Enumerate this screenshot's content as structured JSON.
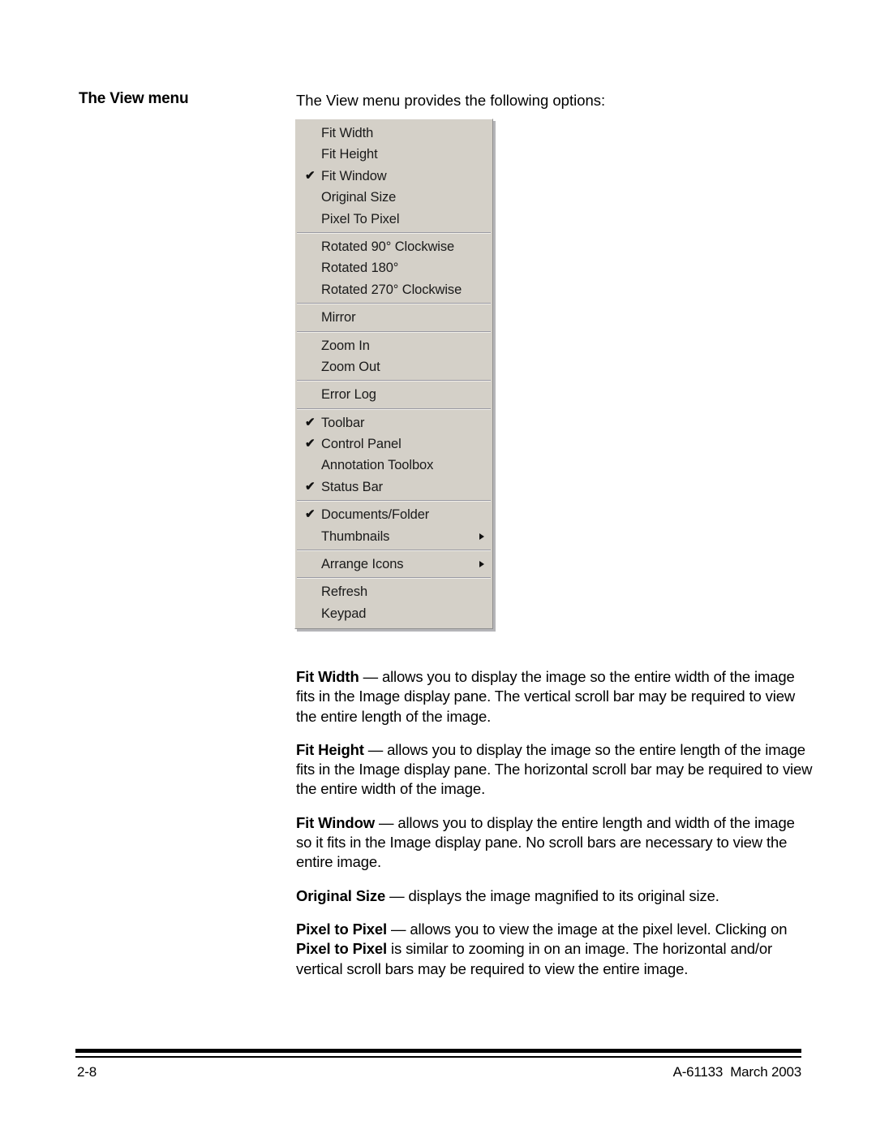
{
  "page": {
    "heading": "The View menu",
    "intro": "The View menu provides the following options:"
  },
  "menu": {
    "name": "View",
    "background_color": "#d4d0c8",
    "groups": [
      {
        "items": [
          {
            "label": "Fit Width",
            "checked": false,
            "submenu": false
          },
          {
            "label": "Fit Height",
            "checked": false,
            "submenu": false
          },
          {
            "label": "Fit Window",
            "checked": true,
            "submenu": false
          },
          {
            "label": "Original Size",
            "checked": false,
            "submenu": false
          },
          {
            "label": "Pixel To Pixel",
            "checked": false,
            "submenu": false
          }
        ]
      },
      {
        "items": [
          {
            "label": "Rotated 90° Clockwise",
            "checked": false,
            "submenu": false
          },
          {
            "label": "Rotated 180°",
            "checked": false,
            "submenu": false
          },
          {
            "label": "Rotated 270° Clockwise",
            "checked": false,
            "submenu": false
          }
        ]
      },
      {
        "items": [
          {
            "label": "Mirror",
            "checked": false,
            "submenu": false
          }
        ]
      },
      {
        "items": [
          {
            "label": "Zoom In",
            "checked": false,
            "submenu": false
          },
          {
            "label": "Zoom Out",
            "checked": false,
            "submenu": false
          }
        ]
      },
      {
        "items": [
          {
            "label": "Error Log",
            "checked": false,
            "submenu": false
          }
        ]
      },
      {
        "items": [
          {
            "label": "Toolbar",
            "checked": true,
            "submenu": false
          },
          {
            "label": "Control Panel",
            "checked": true,
            "submenu": false
          },
          {
            "label": "Annotation Toolbox",
            "checked": false,
            "submenu": false
          },
          {
            "label": "Status Bar",
            "checked": true,
            "submenu": false
          }
        ]
      },
      {
        "items": [
          {
            "label": "Documents/Folder",
            "checked": true,
            "submenu": false
          },
          {
            "label": "Thumbnails",
            "checked": false,
            "submenu": true
          }
        ]
      },
      {
        "items": [
          {
            "label": "Arrange Icons",
            "checked": false,
            "submenu": true
          }
        ]
      },
      {
        "items": [
          {
            "label": "Refresh",
            "checked": false,
            "submenu": false
          },
          {
            "label": "Keypad",
            "checked": false,
            "submenu": false
          }
        ]
      }
    ],
    "checkmark_glyph": "✔",
    "submenu_glyph": "▶"
  },
  "descriptions": [
    {
      "term": "Fit Width",
      "dash": " — ",
      "text": "allows you to display the image so the entire width of the image fits in the Image display pane.  The vertical scroll bar may be required to view the entire length of the image."
    },
    {
      "term": "Fit Height",
      "dash": " — ",
      "text": "allows you to display the image so the entire length of the image fits in the Image display pane.  The horizontal scroll bar may be required to view the entire width of the image."
    },
    {
      "term": "Fit Window",
      "dash": " — ",
      "text": "allows you to display the entire length and width of the image so it fits in the Image display pane.  No scroll bars are necessary to view the entire image."
    },
    {
      "term": "Original Size",
      "dash": " — ",
      "text": "displays the image magnified to its original size."
    },
    {
      "term": "Pixel to Pixel",
      "dash": " — ",
      "text_part1": "allows you to view the image at the pixel level. Clicking on ",
      "term2": "Pixel to Pixel",
      "text_part2": " is similar to zooming in on an image. The horizontal and/or vertical scroll bars may be required to view the entire image."
    }
  ],
  "footer": {
    "page_number": "2-8",
    "doc_reference": "A-61133  March 2003"
  }
}
